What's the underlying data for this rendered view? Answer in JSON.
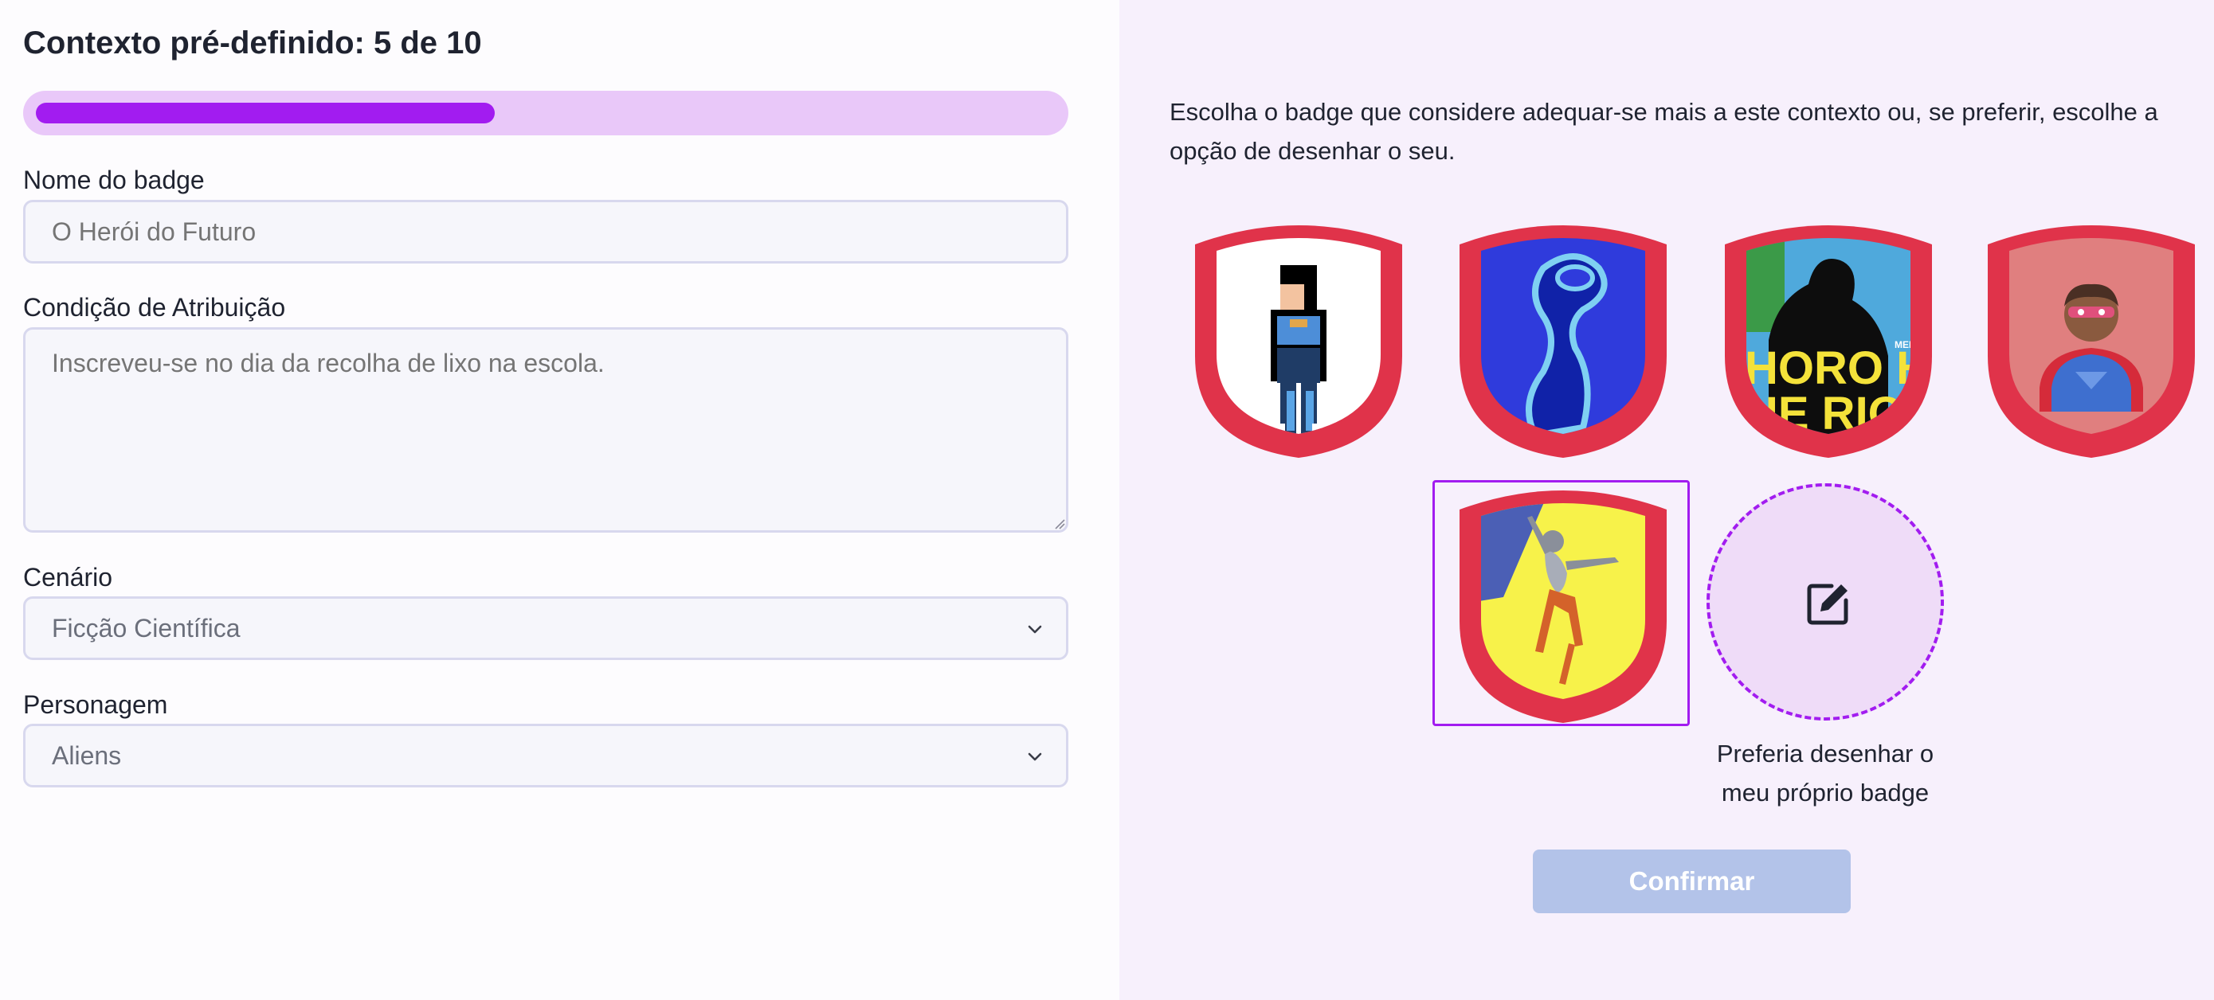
{
  "header": {
    "title": "Contexto pré-definido: 5 de 10"
  },
  "progress": {
    "current": 5,
    "total": 10,
    "fraction": 0.45,
    "fill_color": "#a21cf0",
    "track_color": "#e9c8f9"
  },
  "form": {
    "badge_name": {
      "label": "Nome do badge",
      "placeholder": "O Herói do Futuro"
    },
    "condition": {
      "label": "Condição de Atribuição",
      "placeholder": "Inscreveu-se no dia da recolha de lixo na escola."
    },
    "scenario": {
      "label": "Cenário",
      "selected": "Ficção Científica"
    },
    "character": {
      "label": "Personagem",
      "selected": "Aliens"
    }
  },
  "badges": {
    "intro": "Escolha o badge que considere adequar-se mais a este contexto ou, se preferir, escolhe a opção de desenhar o seu.",
    "items": [
      {
        "name": "pixel-superhero-badge",
        "image_text": ""
      },
      {
        "name": "blue-abstract-figure-badge",
        "image_text": ""
      },
      {
        "name": "comic-poster-badge",
        "image_text": "HORO HE\nHE RIOR",
        "small_text": "MERDI"
      },
      {
        "name": "emoji-superhero-badge",
        "image_text": ""
      },
      {
        "name": "jumping-dancer-badge",
        "image_text": "",
        "selected": true
      }
    ],
    "draw_own": {
      "label": "Preferia desenhar o meu próprio badge",
      "icon": "edit-icon"
    },
    "shield_color": "#e0334a",
    "selected_color": "#a21cf0"
  },
  "actions": {
    "confirm_label": "Confirmar",
    "confirm_color": "#b3c3e9"
  }
}
